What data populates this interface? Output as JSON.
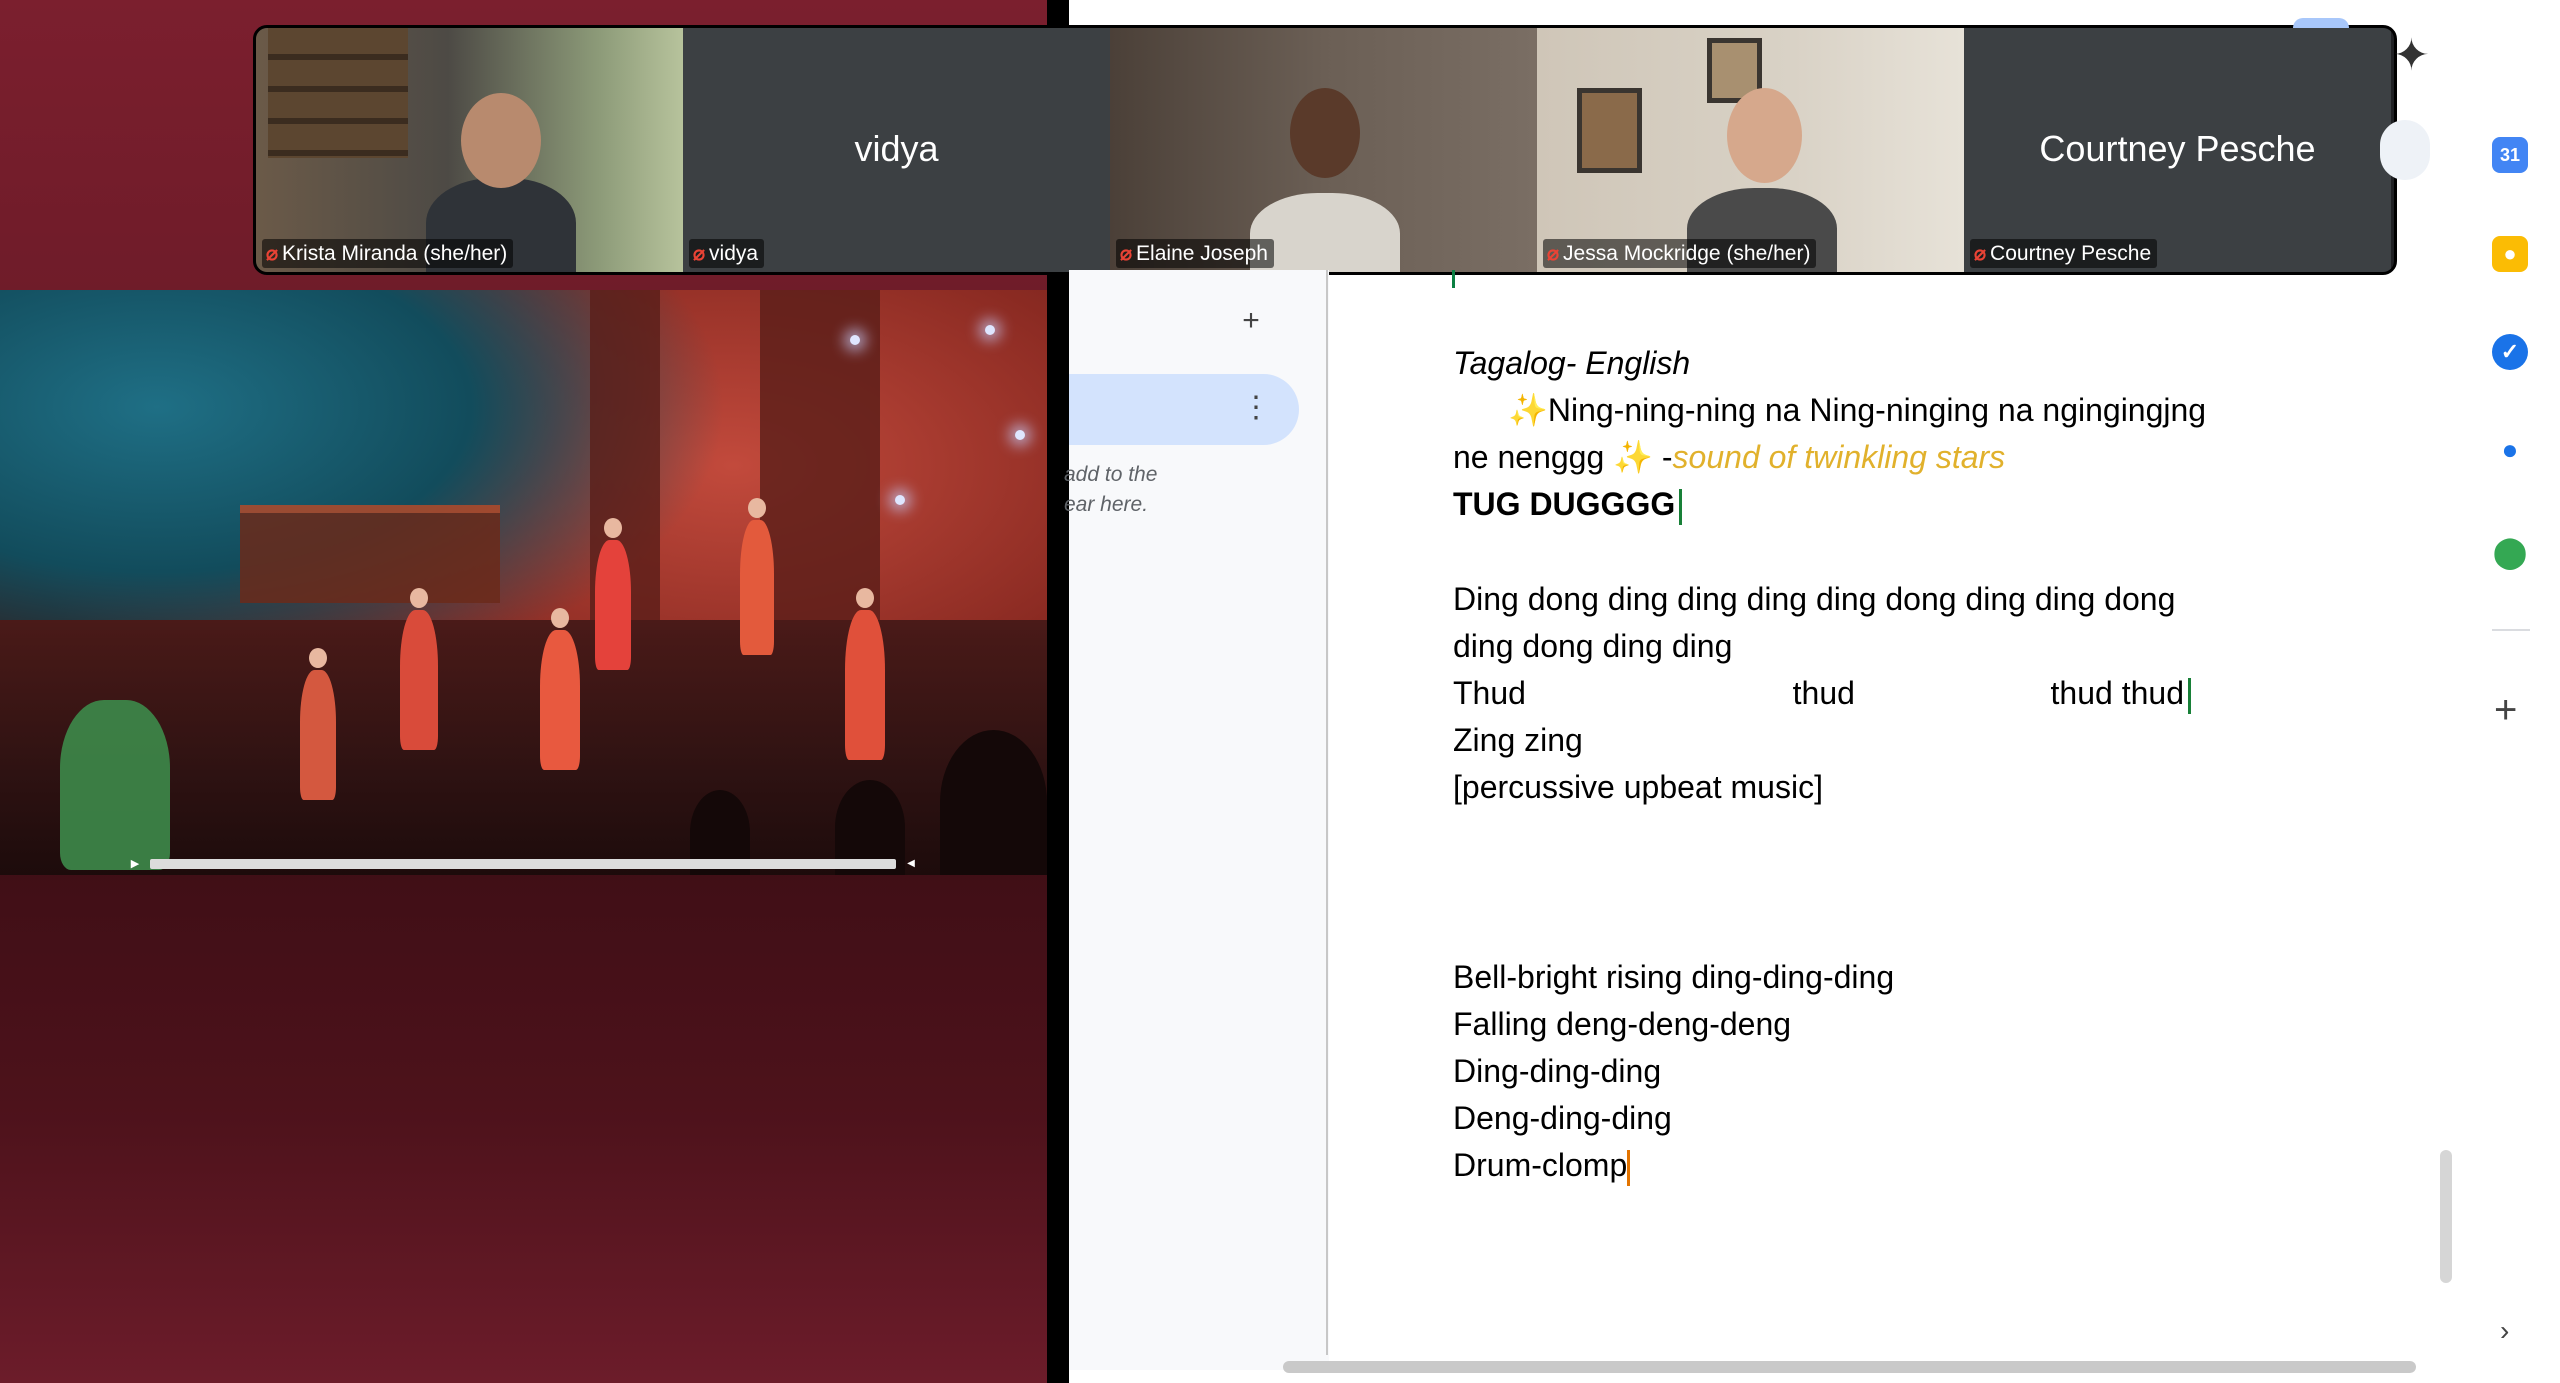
{
  "participants": [
    {
      "name": "Krista Miranda (she/her)",
      "video": true,
      "muted": true
    },
    {
      "name": "vidya",
      "video": false,
      "muted": true
    },
    {
      "name": "Elaine Joseph",
      "video": true,
      "muted": true
    },
    {
      "name": "Jessa Mockridge (she/her)",
      "video": true,
      "muted": true
    },
    {
      "name": "Courtney Pesche",
      "video": false,
      "muted": true
    }
  ],
  "outline": {
    "add_icon": "plus-icon",
    "menu_icon": "kebab-icon",
    "hint": "add to the\near here."
  },
  "document": {
    "heading": "Tagalog- English",
    "line1_sparkle": "✨",
    "line1": "Ning-ning-ning na Ning-ninging na ngingingjng",
    "line2_a": "ne nenggg ",
    "line2_sparkle": "✨",
    "line2_dash": " -",
    "line2_note": "sound of twinkling stars",
    "line3": "TUG DUGGGG",
    "line4": "Ding dong ding ding ding ding dong ding ding dong",
    "line5": "ding dong ding ding",
    "line6": "Thud                              thud                      thud thud",
    "line7": "Zing zing",
    "line8": "[percussive upbeat music]",
    "line9": "Bell-bright rising ding-ding-ding",
    "line10": "Falling deng-deng-deng",
    "line11": "Ding-ding-ding",
    "line12": "Deng-ding-ding",
    "line13": "Drum-clomp"
  },
  "side_panel": {
    "icons": [
      "calendar-icon",
      "keep-icon",
      "tasks-icon",
      "contacts-icon",
      "maps-icon"
    ],
    "calendar_day": "31",
    "colors": {
      "calendar": "#4285f4",
      "keep": "#fbbc04",
      "tasks": "#1a73e8",
      "contacts": "#1a73e8",
      "maps": "#34a853"
    }
  },
  "colors": {
    "left_panel": "#6a1a27",
    "accent_yellow": "#e1b12c",
    "mic_off": "#ea4335"
  }
}
